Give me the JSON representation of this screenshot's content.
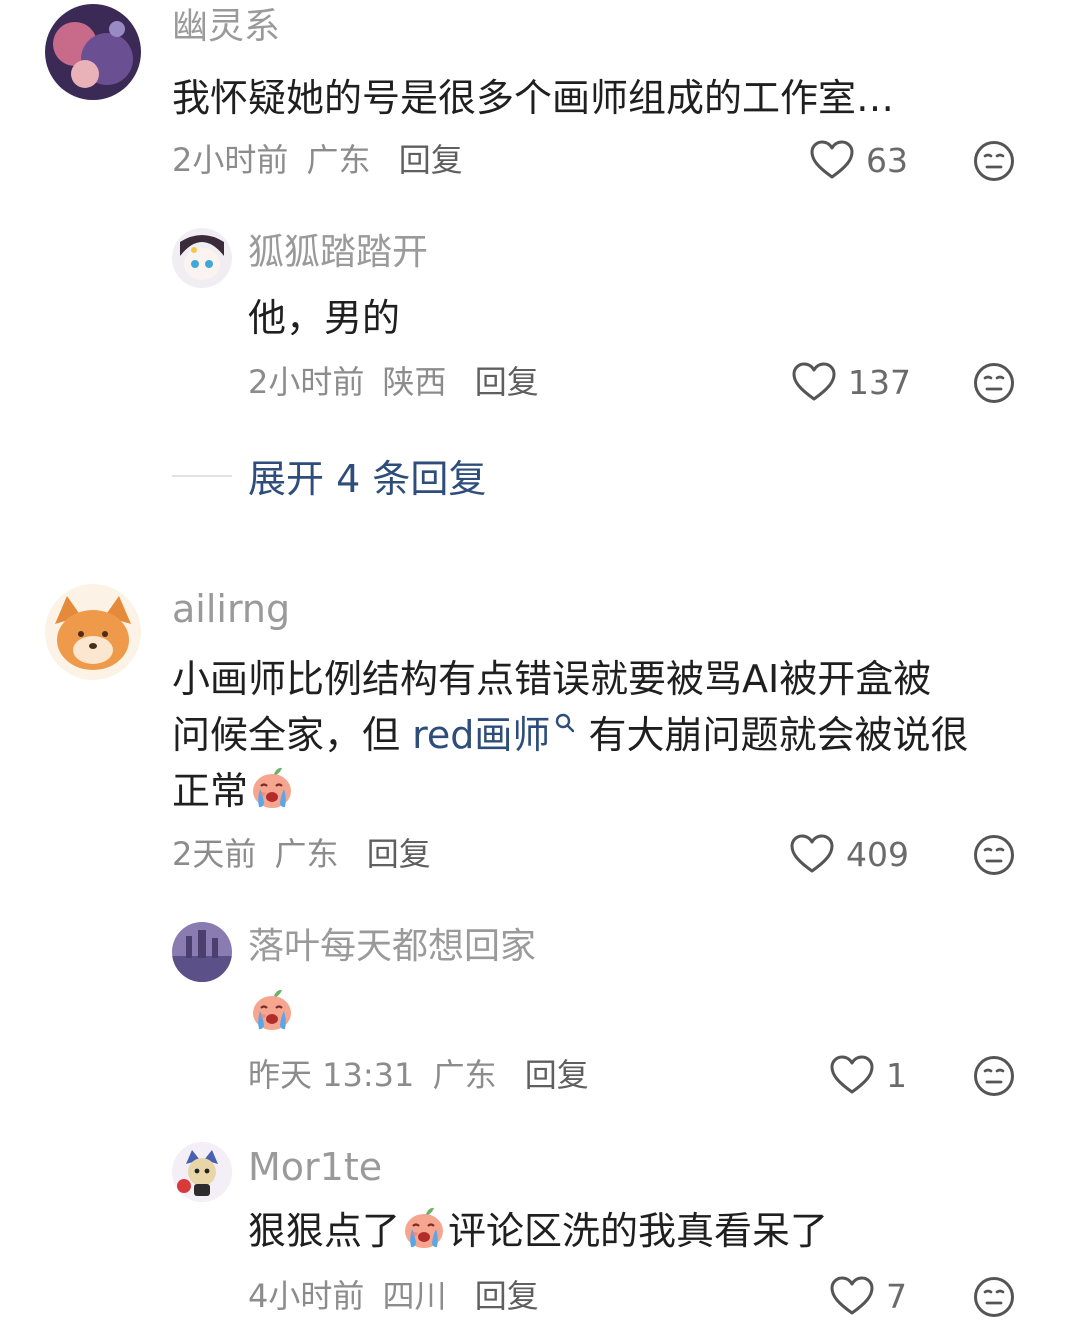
{
  "comments": [
    {
      "user": "幽灵系",
      "text": "我怀疑她的号是很多个画师组成的工作室…",
      "time": "2小时前",
      "location": "广东",
      "reply": "回复",
      "likes": "63"
    },
    {
      "user": "狐狐踏踏开",
      "text": "他，男的",
      "time": "2小时前",
      "location": "陕西",
      "reply": "回复",
      "likes": "137"
    },
    {
      "user": "ailirng",
      "text_line1": "小画师比例结构有点错误就要被骂AI被开盒被",
      "text_line2_a": "问候全家，但 ",
      "text_line2_link": "red画师",
      "text_line2_b": " 有大崩问题就会被说很",
      "text_line3": "正常",
      "time": "2天前",
      "location": "广东",
      "reply": "回复",
      "likes": "409"
    },
    {
      "user": "落叶每天都想回家",
      "time": "昨天 13:31",
      "location": "广东",
      "reply": "回复",
      "likes": "1"
    },
    {
      "user": "Mor1te",
      "text_a": "狠狠点了",
      "text_b": "评论区洗的我真看呆了",
      "time": "4小时前",
      "location": "四川",
      "reply": "回复",
      "likes": "7"
    }
  ],
  "expand_label": "展开 4 条回复",
  "icons": {
    "like": "heart-outline-icon",
    "dislike": "neutral-face-icon",
    "search": "search-icon",
    "emoji": "crying-face-emoji"
  },
  "colors": {
    "link": "#2e4d7a",
    "meta": "#8c8c8c",
    "username": "#9a9a9a"
  }
}
